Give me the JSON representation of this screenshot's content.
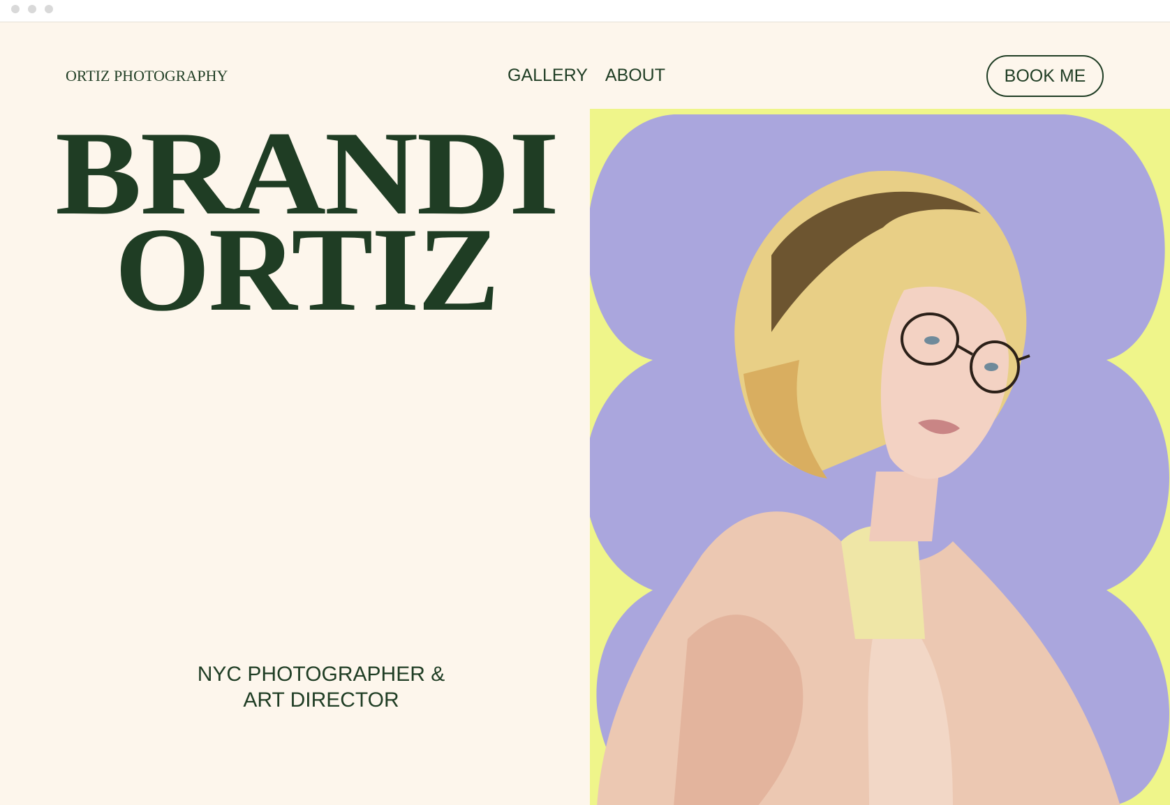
{
  "window": {
    "controls": [
      "close-dot",
      "minimize-dot",
      "maximize-dot"
    ]
  },
  "header": {
    "logo": "ORTIZ PHOTOGRAPHY",
    "nav": [
      {
        "label": "GALLERY"
      },
      {
        "label": "ABOUT"
      }
    ],
    "cta": "BOOK ME"
  },
  "hero": {
    "name_line1": "BRANDI",
    "name_line2": "ORTIZ",
    "tagline_line1": "NYC PHOTOGRAPHER &",
    "tagline_line2": "ART DIRECTOR"
  },
  "colors": {
    "background": "#fdf6ec",
    "text": "#1f3d24",
    "panel": "#eff58a",
    "shape": "#aaa6dd"
  }
}
